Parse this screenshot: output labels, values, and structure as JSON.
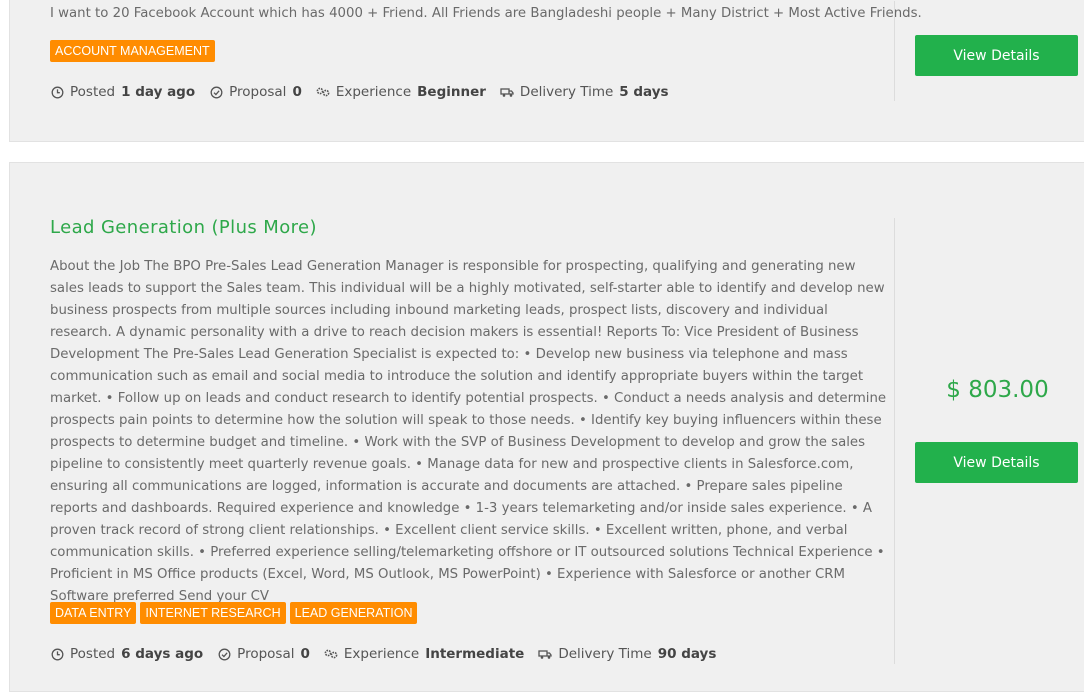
{
  "jobs": [
    {
      "title": "",
      "description": "I want to 20 Facebook Account which has 4000 + Friend. All Friends are Bangladeshi people + Many District + Most Active Friends.",
      "tags": [
        "ACCOUNT MANAGEMENT"
      ],
      "posted_label": "Posted",
      "posted_value": "1 day ago",
      "proposal_label": "Proposal",
      "proposal_value": "0",
      "experience_label": "Experience",
      "experience_value": "Beginner",
      "delivery_label": "Delivery Time",
      "delivery_value": "5 days",
      "price": "",
      "button_label": "View Details"
    },
    {
      "title": "Lead Generation (Plus More)",
      "description": "About the Job The BPO Pre-Sales Lead Generation Manager is responsible for prospecting, qualifying and generating new sales leads to support the Sales team. This individual will be a highly motivated, self-starter able to identify and develop new business prospects from multiple sources including inbound marketing leads, prospect lists, discovery and individual research. A dynamic personality with a drive to reach decision makers is essential! Reports To: Vice President of Business Development The Pre-Sales Lead Generation Specialist is expected to: • Develop new business via telephone and mass communication such as email and social media to introduce the solution and identify appropriate buyers within the target market. • Follow up on leads and conduct research to identify potential prospects. • Conduct a needs analysis and determine prospects pain points to determine how the solution will speak to those needs. • Identify key buying influencers within these prospects to determine budget and timeline. • Work with the SVP of Business Development to develop and grow the sales pipeline to consistently meet quarterly revenue goals. • Manage data for new and prospective clients in Salesforce.com, ensuring all communications are logged, information is accurate and documents are attached. • Prepare sales pipeline reports and dashboards. Required experience and knowledge • 1-3 years telemarketing and/or inside sales experience. • A proven track record of strong client relationships. • Excellent client service skills. • Excellent written, phone, and verbal communication skills. • Preferred experience selling/telemarketing offshore or IT outsourced solutions Technical Experience • Proficient in MS Office products (Excel, Word, MS Outlook, MS PowerPoint) • Experience with Salesforce or another CRM Software preferred Send your CV",
      "tags": [
        "DATA ENTRY",
        "INTERNET RESEARCH",
        "LEAD GENERATION"
      ],
      "posted_label": "Posted",
      "posted_value": "6 days ago",
      "proposal_label": "Proposal",
      "proposal_value": "0",
      "experience_label": "Experience",
      "experience_value": "Intermediate",
      "delivery_label": "Delivery Time",
      "delivery_value": "90 days",
      "price": "$ 803.00",
      "button_label": "View Details"
    }
  ],
  "icons": [
    "clock-icon",
    "check-circle-icon",
    "experience-icon",
    "delivery-truck-icon"
  ],
  "colors": {
    "accent_green": "#22b14c",
    "title_green": "#2ea84a",
    "tag_orange": "#ff8c00",
    "card_bg": "#f0f0f0"
  }
}
